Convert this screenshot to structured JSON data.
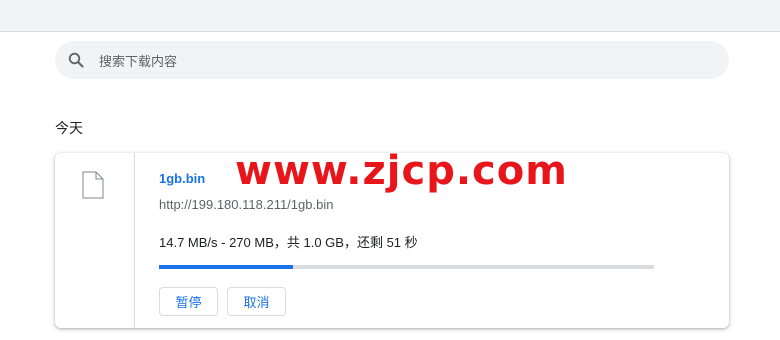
{
  "search": {
    "placeholder": "搜索下载内容",
    "icon": "search-icon"
  },
  "section": {
    "date_heading": "今天"
  },
  "download": {
    "file_name": "1gb.bin",
    "url": "http://199.180.118.211/1gb.bin",
    "status": "14.7 MB/s - 270 MB，共 1.0 GB，还剩 51 秒",
    "progress": 0.27,
    "icon": "file-icon",
    "pause_label": "暂停",
    "cancel_label": "取消"
  },
  "watermark": "www.zjcp.com",
  "colors": {
    "accent": "#1a73e8",
    "watermark": "#e8151b",
    "track": "#dadce0"
  }
}
